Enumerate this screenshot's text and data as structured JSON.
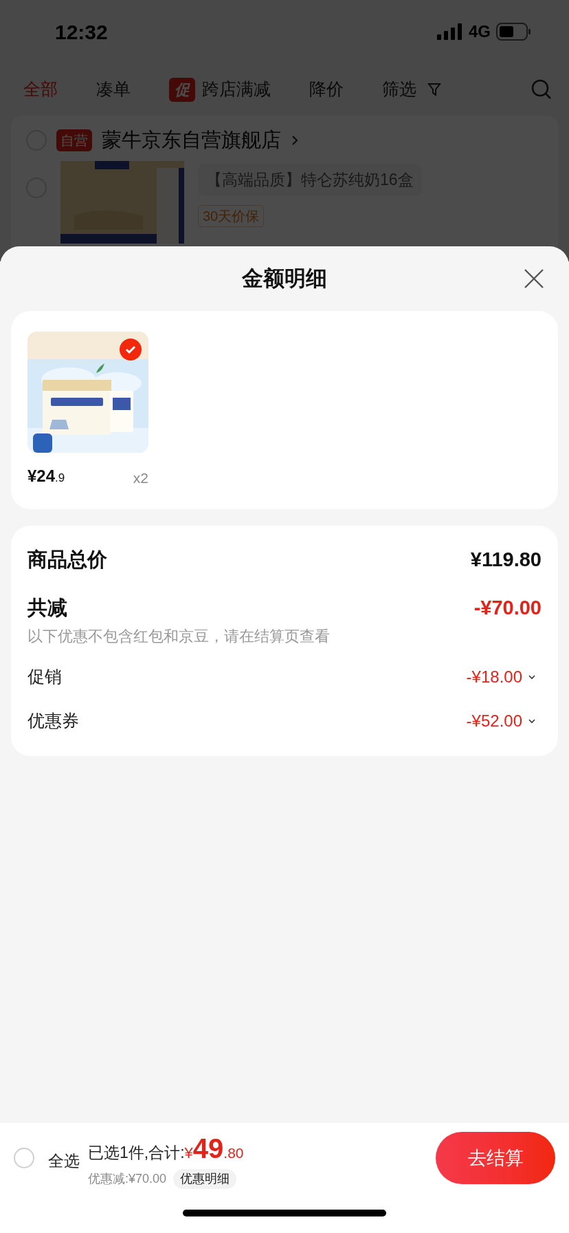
{
  "status_bar": {
    "time": "12:32",
    "network": "4G"
  },
  "tabs": [
    {
      "label": "全部",
      "selected": true
    },
    {
      "label": "凑单",
      "selected": false
    },
    {
      "label": "跨店满减",
      "badge": "促",
      "selected": false
    },
    {
      "label": "降价",
      "selected": false
    },
    {
      "label": "筛选",
      "selected": false
    }
  ],
  "store": {
    "badge": "自营",
    "name": "蒙牛京东自营旗舰店",
    "checked": false
  },
  "cart_item": {
    "title": "【高端品质】特仑苏纯奶16盒",
    "tag": "30天价保",
    "checked": false
  },
  "sheet": {
    "title": "金额明细",
    "items": [
      {
        "price_main": "¥24",
        "price_decimal": ".9",
        "quantity": "x2",
        "checked": true
      }
    ],
    "summary": {
      "total_label": "商品总价",
      "total_value": "¥119.80",
      "discount_label": "共减",
      "discount_value": "-¥70.00",
      "note": "以下优惠不包含红包和京豆，请在结算页查看",
      "rows": [
        {
          "label": "促销",
          "value": "-¥18.00",
          "expanded": false
        },
        {
          "label": "优惠券",
          "value": "-¥52.00",
          "expanded": false
        }
      ]
    }
  },
  "bottom_bar": {
    "select_all_label": "全选",
    "select_all_checked": false,
    "selected_text": "已选1件,合计:",
    "currency": "¥",
    "total_main": "49",
    "total_decimal": ".80",
    "discount_text": "优惠减:¥70.00",
    "detail_button": "优惠明细",
    "checkout_button": "去结算"
  }
}
